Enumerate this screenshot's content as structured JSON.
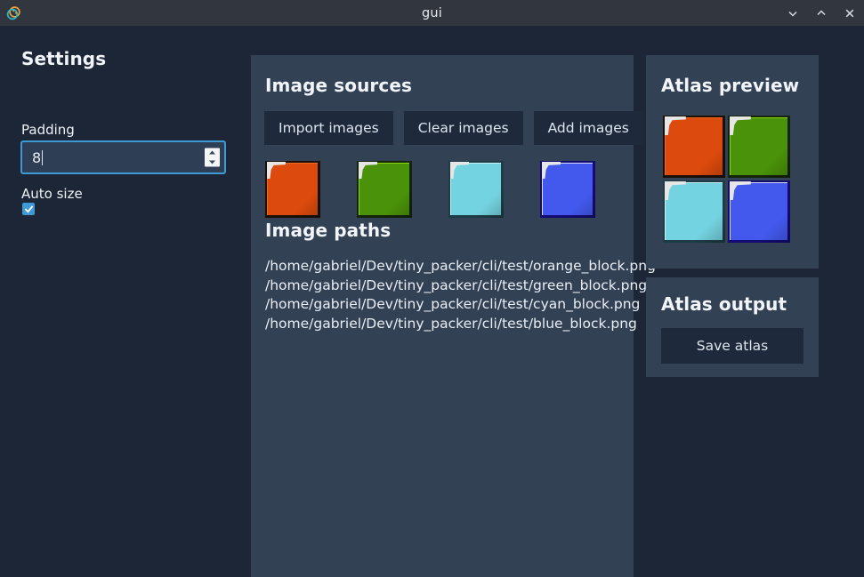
{
  "window": {
    "title": "gui",
    "icon": "app-logo-icon",
    "controls": [
      {
        "name": "minimize-button",
        "icon": "chevron-down-icon"
      },
      {
        "name": "maximize-button",
        "icon": "chevron-up-icon"
      },
      {
        "name": "close-button",
        "icon": "close-icon"
      }
    ]
  },
  "settings": {
    "title": "Settings",
    "padding": {
      "label": "Padding",
      "value": "8",
      "spinner_up_icon": "spinner-up-icon",
      "spinner_down_icon": "spinner-down-icon"
    },
    "auto_size": {
      "label": "Auto size",
      "checked": true,
      "check_icon": "check-icon"
    }
  },
  "image_sources": {
    "title": "Image sources",
    "buttons": [
      {
        "name": "import-images-button",
        "label": "Import images"
      },
      {
        "name": "clear-images-button",
        "label": "Clear images"
      },
      {
        "name": "add-images-button",
        "label": "Add images"
      }
    ],
    "thumbnails": [
      {
        "name": "orange-block-thumbnail",
        "color": "#dc4a0d",
        "border": "#1a1008",
        "edge": "#f06a20"
      },
      {
        "name": "green-block-thumbnail",
        "color": "#4a9209",
        "border": "#14240a",
        "edge": "#8fd612"
      },
      {
        "name": "cyan-block-thumbnail",
        "color": "#74d3e0",
        "border": "#1e3c46",
        "edge": "#cdeff6"
      },
      {
        "name": "blue-block-thumbnail",
        "color": "#4359ee",
        "border": "#130a72",
        "edge": "#d8dcf6"
      }
    ],
    "paths_title": "Image paths",
    "paths": [
      "/home/gabriel/Dev/tiny_packer/cli/test/orange_block.png",
      "/home/gabriel/Dev/tiny_packer/cli/test/green_block.png",
      "/home/gabriel/Dev/tiny_packer/cli/test/cyan_block.png",
      "/home/gabriel/Dev/tiny_packer/cli/test/blue_block.png"
    ]
  },
  "atlas_preview": {
    "title": "Atlas preview",
    "cells": [
      {
        "name": "atlas-cell-orange",
        "color": "#dc4a0d",
        "border": "#1a1008",
        "edge": "#f06a20"
      },
      {
        "name": "atlas-cell-green",
        "color": "#4a9209",
        "border": "#14240a",
        "edge": "#8fd612"
      },
      {
        "name": "atlas-cell-cyan",
        "color": "#74d3e0",
        "border": "#1e3c46",
        "edge": "#cdeff6"
      },
      {
        "name": "atlas-cell-blue",
        "color": "#4359ee",
        "border": "#130a72",
        "edge": "#d8dcf6"
      }
    ]
  },
  "atlas_output": {
    "title": "Atlas output",
    "save_label": "Save atlas"
  },
  "colors": {
    "window_chrome": "#32373f",
    "app_background": "#1d2636",
    "panel_background": "#334155",
    "button_background": "#1e293b",
    "accent": "#3d9ad4",
    "text": "#e9eef5"
  }
}
